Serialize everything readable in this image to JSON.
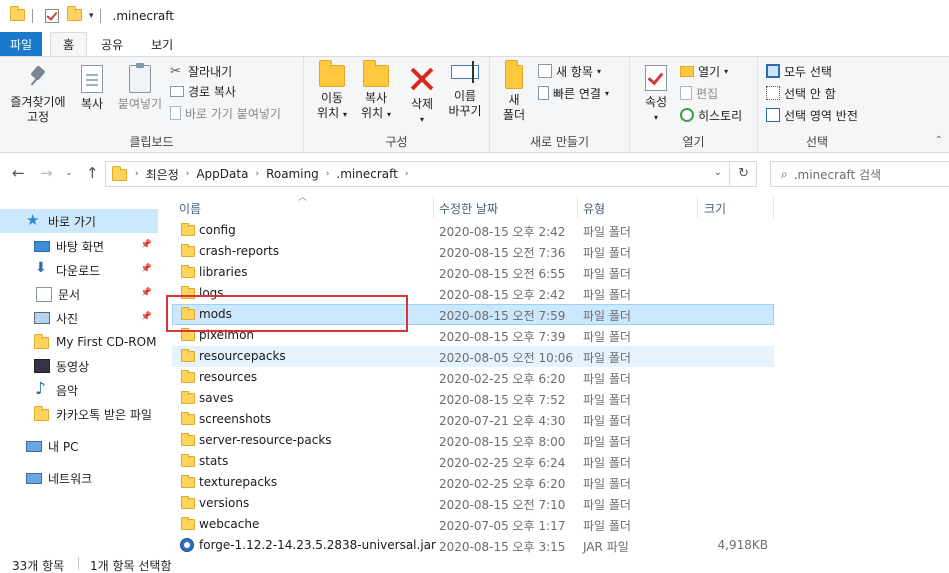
{
  "window": {
    "title": ".minecraft"
  },
  "ribbon_tabs": [
    "파일",
    "홈",
    "공유",
    "보기"
  ],
  "ribbon": {
    "clipboard": {
      "label": "클립보드",
      "pin_label_line1": "즐겨찾기에",
      "pin_label_line2": "고정",
      "copy": "복사",
      "paste": "붙여넣기",
      "cut": "잘라내기",
      "copy_path": "경로 복사",
      "paste_shortcut": "바로 가기 붙여넣기"
    },
    "organize": {
      "label": "구성",
      "move_line1": "이동",
      "move_line2": "위치",
      "copy_line1": "복사",
      "copy_line2": "위치",
      "delete": "삭제",
      "rename_line1": "이름",
      "rename_line2": "바꾸기"
    },
    "new": {
      "label": "새로 만들기",
      "folder_line1": "새",
      "folder_line2": "폴더",
      "new_item": "새 항목",
      "easy_access": "빠른 연결"
    },
    "open": {
      "label": "열기",
      "properties": "속성",
      "open": "열기",
      "edit": "편집",
      "history": "히스토리"
    },
    "select": {
      "label": "선택",
      "select_all": "모두 선택",
      "select_none": "선택 안 함",
      "invert": "선택 영역 반전"
    }
  },
  "address": {
    "crumbs": [
      "최은정",
      "AppData",
      "Roaming",
      ".minecraft"
    ],
    "search_placeholder": ".minecraft 검색"
  },
  "nav_pane": {
    "items": [
      {
        "label": "바로 가기",
        "icon": "star-icon"
      },
      {
        "label": "바탕 화면",
        "icon": "desktop-icon"
      },
      {
        "label": "다운로드",
        "icon": "download-icon"
      },
      {
        "label": "문서",
        "icon": "documents-icon"
      },
      {
        "label": "사진",
        "icon": "pictures-icon"
      },
      {
        "label": "My First CD-ROM I",
        "icon": "folder-icon"
      },
      {
        "label": "동영상",
        "icon": "video-icon"
      },
      {
        "label": "음악",
        "icon": "music-icon"
      },
      {
        "label": "카카오톡 받은 파일",
        "icon": "folder-icon"
      },
      {
        "label": "내 PC",
        "icon": "pc-icon"
      },
      {
        "label": "네트워크",
        "icon": "network-icon"
      }
    ]
  },
  "columns": {
    "name": "이름",
    "date": "수정한 날짜",
    "type": "유형",
    "size": "크기"
  },
  "files": [
    {
      "name": "config",
      "date": "2020-08-15 오후 2:42",
      "type": "파일 폴더",
      "size": ""
    },
    {
      "name": "crash-reports",
      "date": "2020-08-15 오전 7:36",
      "type": "파일 폴더",
      "size": ""
    },
    {
      "name": "libraries",
      "date": "2020-08-15 오전 6:55",
      "type": "파일 폴더",
      "size": ""
    },
    {
      "name": "logs",
      "date": "2020-08-15 오후 2:42",
      "type": "파일 폴더",
      "size": ""
    },
    {
      "name": "mods",
      "date": "2020-08-15 오전 7:59",
      "type": "파일 폴더",
      "size": ""
    },
    {
      "name": "pixelmon",
      "date": "2020-08-15 오후 7:39",
      "type": "파일 폴더",
      "size": ""
    },
    {
      "name": "resourcepacks",
      "date": "2020-08-05 오전 10:06",
      "type": "파일 폴더",
      "size": ""
    },
    {
      "name": "resources",
      "date": "2020-02-25 오후 6:20",
      "type": "파일 폴더",
      "size": ""
    },
    {
      "name": "saves",
      "date": "2020-08-15 오후 7:52",
      "type": "파일 폴더",
      "size": ""
    },
    {
      "name": "screenshots",
      "date": "2020-07-21 오후 4:30",
      "type": "파일 폴더",
      "size": ""
    },
    {
      "name": "server-resource-packs",
      "date": "2020-08-15 오후 8:00",
      "type": "파일 폴더",
      "size": ""
    },
    {
      "name": "stats",
      "date": "2020-02-25 오후 6:24",
      "type": "파일 폴더",
      "size": ""
    },
    {
      "name": "texturepacks",
      "date": "2020-02-25 오후 6:20",
      "type": "파일 폴더",
      "size": ""
    },
    {
      "name": "versions",
      "date": "2020-08-15 오전 7:10",
      "type": "파일 폴더",
      "size": ""
    },
    {
      "name": "webcache",
      "date": "2020-07-05 오후 1:17",
      "type": "파일 폴더",
      "size": ""
    },
    {
      "name": "forge-1.12.2-14.23.5.2838-universal.jar",
      "date": "2020-08-15 오후 3:15",
      "type": "JAR 파일",
      "size": "4,918KB"
    }
  ],
  "status": {
    "item_count": "33개 항목",
    "selected": "1개 항목 선택함"
  },
  "colors": {
    "accent": "#1979ca",
    "selection": "#cce8ff",
    "highlight_box": "#d8343a"
  }
}
